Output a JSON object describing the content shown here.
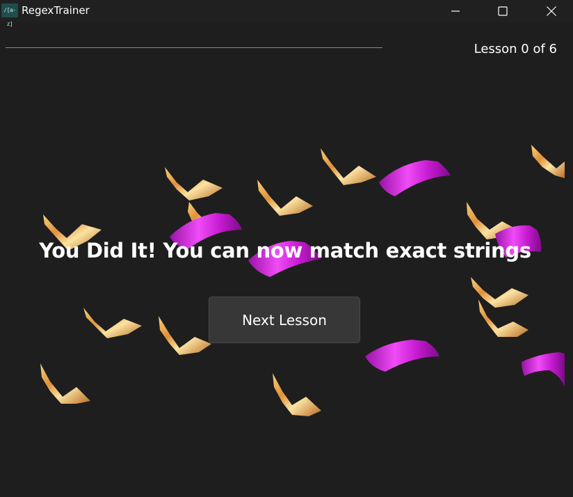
{
  "window": {
    "title": "RegexTrainer",
    "icon_text": "/[a-z]"
  },
  "progress": {
    "value": 0
  },
  "lesson_counter": "Lesson 0 of 6",
  "completion": {
    "message": "You Did It! You can now match exact strings",
    "next_button_label": "Next Lesson"
  },
  "colors": {
    "background": "#1e1e1e",
    "titlebar": "#202020",
    "button": "#373737",
    "confetti_gold": "#e8a04a",
    "confetti_magenta": "#d21fdc"
  },
  "icons": [
    "minimize-icon",
    "maximize-icon",
    "close-icon",
    "confetti-ribbon"
  ]
}
